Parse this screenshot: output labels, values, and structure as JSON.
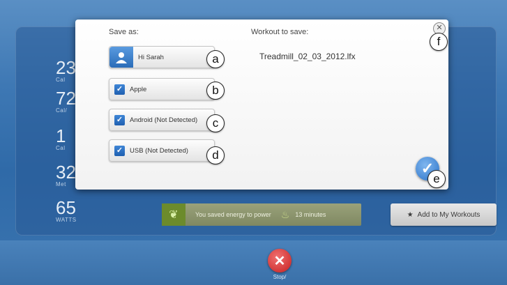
{
  "stats": [
    {
      "value": "23",
      "unit": "Cal"
    },
    {
      "value": "72",
      "unit": "Cal/"
    },
    {
      "value": "1",
      "unit": "Cal"
    },
    {
      "value": "32",
      "unit": "Met"
    },
    {
      "value": "65",
      "unit": "WATTS"
    }
  ],
  "energy": {
    "text": "You saved energy to power",
    "minutes": "13 minutes"
  },
  "add_button": {
    "label": "Add to My Workouts",
    "icon": "star-icon"
  },
  "stop": {
    "label": "Stop/"
  },
  "dialog": {
    "save_as_label": "Save as:",
    "workout_label": "Workout to save:",
    "filename": "Treadmill_02_03_2012.lfx",
    "user": {
      "name": "Hi Sarah",
      "icon": "user-avatar-icon"
    },
    "options": [
      {
        "label": "Apple",
        "checked": true
      },
      {
        "label": "Android (Not Detected)",
        "checked": true
      },
      {
        "label": "USB (Not Detected)",
        "checked": true
      }
    ],
    "close_glyph": "✕",
    "confirm_glyph": "✓"
  },
  "callouts": [
    "a",
    "b",
    "c",
    "d",
    "e",
    "f"
  ],
  "colors": {
    "accent": "#2a72c8",
    "stop": "#c61f1f",
    "energy": "#7f8862"
  }
}
